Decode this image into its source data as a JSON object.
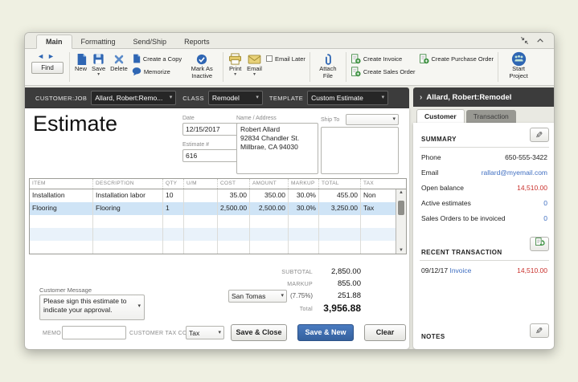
{
  "ribbon_tabs": {
    "main": "Main",
    "formatting": "Formatting",
    "send_ship": "Send/Ship",
    "reports": "Reports"
  },
  "toolbar": {
    "find": "Find",
    "new": "New",
    "save": "Save",
    "delete": "Delete",
    "create_a_copy": "Create a Copy",
    "memorize": "Memorize",
    "mark_as_inactive": "Mark As Inactive",
    "print": "Print",
    "email": "Email",
    "email_later": "Email Later",
    "attach_file": "Attach File",
    "create_invoice": "Create Invoice",
    "create_sales_order": "Create Sales Order",
    "create_purchase_order": "Create Purchase Order",
    "start_project": "Start Project"
  },
  "customer_bar": {
    "customer_job_label": "CUSTOMER:JOB",
    "customer_job_value": "Allard, Robert:Remo...",
    "class_label": "CLASS",
    "class_value": "Remodel",
    "template_label": "TEMPLATE",
    "template_value": "Custom Estimate"
  },
  "form": {
    "title": "Estimate",
    "date_label": "Date",
    "date_value": "12/15/2017",
    "estimate_label": "Estimate #",
    "estimate_value": "616",
    "name_address_label": "Name / Address",
    "name_address": "Robert Allard\n92834 Chandler St.\nMillbrae, CA 94030",
    "ship_to_label": "Ship To",
    "ship_to_value": ""
  },
  "items_table": {
    "headers": [
      "ITEM",
      "DESCRIPTION",
      "QTY",
      "U/M",
      "COST",
      "AMOUNT",
      "MARKUP",
      "TOTAL",
      "TAX"
    ],
    "rows": [
      {
        "item": "Installation",
        "description": "Installation labor",
        "qty": "10",
        "um": "",
        "cost": "35.00",
        "amount": "350.00",
        "markup": "30.0%",
        "total": "455.00",
        "tax": "Non"
      },
      {
        "item": "Flooring",
        "description": "Flooring",
        "qty": "1",
        "um": "",
        "cost": "2,500.00",
        "amount": "2,500.00",
        "markup": "30.0%",
        "total": "3,250.00",
        "tax": "Tax"
      }
    ]
  },
  "totals": {
    "subtotal_label": "SUBTOTAL",
    "subtotal_value": "2,850.00",
    "markup_label": "MARKUP",
    "markup_value": "855.00",
    "tax_name": "San Tomas",
    "tax_rate_label": "(7.75%)",
    "tax_value": "251.88",
    "total_label": "Total",
    "total_value": "3,956.88"
  },
  "footer": {
    "customer_message_label": "Customer Message",
    "customer_message_value": "Please sign this estimate to indicate your approval.",
    "memo_label": "MEMO",
    "memo_value": "",
    "customer_tax_code_label": "CUSTOMER TAX CODE",
    "customer_tax_code_value": "Tax",
    "save_close_button": "Save & Close",
    "save_new_button": "Save & New",
    "clear_button": "Clear"
  },
  "panel": {
    "header": "Allard, Robert:Remodel",
    "tab_customer": "Customer",
    "tab_transaction": "Transaction",
    "summary_title": "SUMMARY",
    "summary_rows": [
      {
        "label": "Phone",
        "value": "650-555-3422"
      },
      {
        "label": "Email",
        "value": "rallard@myemail.com"
      },
      {
        "label": "Open balance",
        "value": "14,510.00"
      },
      {
        "label": "Active estimates",
        "value": "0"
      },
      {
        "label": "Sales Orders to be invoiced",
        "value": "0"
      }
    ],
    "recent_title": "RECENT TRANSACTION",
    "recent_date": "09/12/17",
    "recent_type": "Invoice",
    "recent_amount": "14,510.00",
    "notes_title": "NOTES"
  },
  "colors": {
    "brand_blue": "#2f66b3",
    "primary_button": "#35619e",
    "link_blue": "#3f6ec1",
    "negative_red": "#c9302c",
    "dark_bar": "#3c3c3c",
    "row_highlight": "#cfe4f6"
  }
}
